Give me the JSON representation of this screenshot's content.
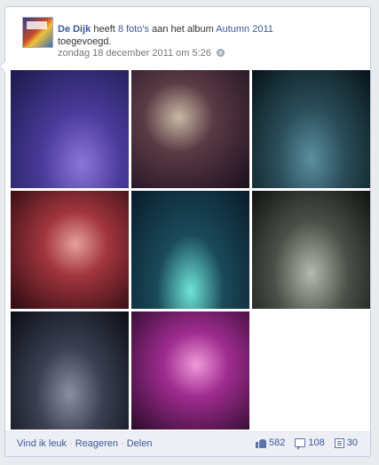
{
  "post": {
    "author": "De Dijk",
    "verb": "heeft",
    "photo_count_link": "8 foto's",
    "mid_text": "aan het album",
    "album": "Autumn 2011",
    "tail": "toegevoegd.",
    "timestamp": "zondag 18 december 2011 om 5:26"
  },
  "photos": [
    {
      "icon": "concert-hall-crowd"
    },
    {
      "icon": "saxophonist-on-stage"
    },
    {
      "icon": "balcony-crowd"
    },
    {
      "icon": "guitarist-red-light"
    },
    {
      "icon": "keyboardist"
    },
    {
      "icon": "hall-audience"
    },
    {
      "icon": "drummer-stage"
    },
    {
      "icon": "singer-pink-light"
    }
  ],
  "footer": {
    "like": "Vind ik leuk",
    "comment": "Reageren",
    "share": "Delen",
    "likes_count": "582",
    "comments_count": "108",
    "shares_count": "30"
  },
  "colors": {
    "link": "#3b5998",
    "footer_bg": "#edeff4"
  }
}
